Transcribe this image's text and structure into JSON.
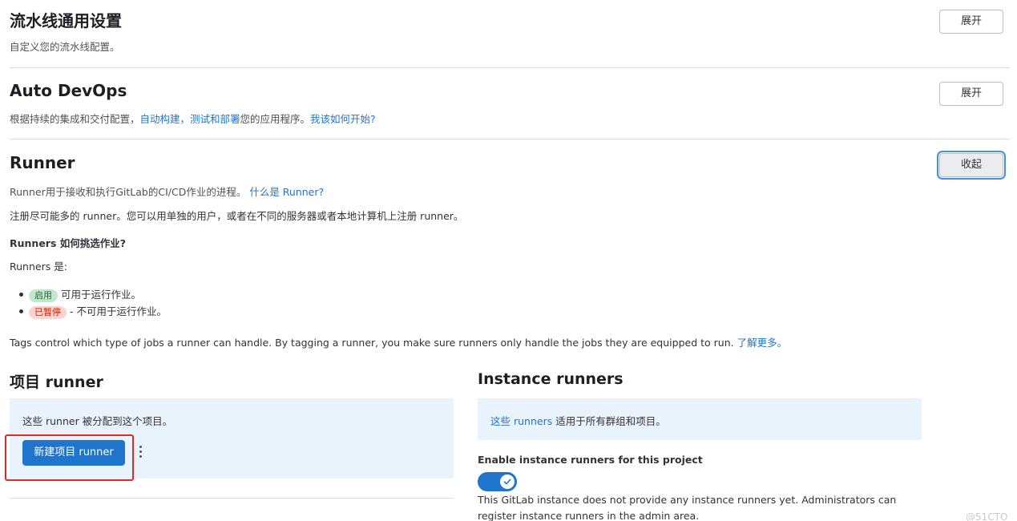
{
  "pipeline": {
    "title": "流水线通用设置",
    "description": "自定义您的流水线配置。",
    "expand_label": "展开"
  },
  "auto_devops": {
    "title": "Auto DevOps",
    "desc_prefix": "根据持续的集成和交付配置，",
    "desc_link": "自动构建，测试和部署",
    "desc_middle": "您的应用程序。",
    "help_link": "我该如何开始?",
    "expand_label": "展开"
  },
  "runner": {
    "title": "Runner",
    "collapse_label": "收起",
    "intro": "Runner用于接收和执行GitLab的CI/CD作业的进程。",
    "intro_link": "什么是 Runner?",
    "register_text": "注册尽可能多的 runner。您可以用单独的用户，或者在不同的服务器或者本地计算机上注册 runner。",
    "pick_heading": "Runners 如何挑选作业?",
    "runners_are": "Runners 是:",
    "states": [
      {
        "badge": "启用",
        "text": "可用于运行作业。",
        "color": "#c3e6cd"
      },
      {
        "badge": "已暂停",
        "text": "- 不可用于运行作业。",
        "color": "#fdd4cd"
      }
    ],
    "tags_text": "Tags control which type of jobs a runner can handle. By tagging a runner, you make sure runners only handle the jobs they are equipped to run.",
    "tags_link": "了解更多。"
  },
  "project_runners": {
    "title": "项目 runner",
    "panel_text": "这些 runner 被分配到这个项目。",
    "new_button": "新建项目 runner",
    "more_icon": "vertical-ellipsis-icon"
  },
  "instance_runners": {
    "title": "Instance runners",
    "panel_link": "这些 runners",
    "panel_text": "适用于所有群组和项目。",
    "toggle_label": "Enable instance runners for this project",
    "toggle_on": true,
    "note_line1": "This GitLab instance does not provide any instance runners yet. Administrators can",
    "note_line2": "register instance runners in the admin area."
  },
  "watermark": "@51CTO",
  "colors": {
    "accent": "#1f75cb",
    "panel": "#e9f3fc",
    "highlight": "#e8262a"
  }
}
